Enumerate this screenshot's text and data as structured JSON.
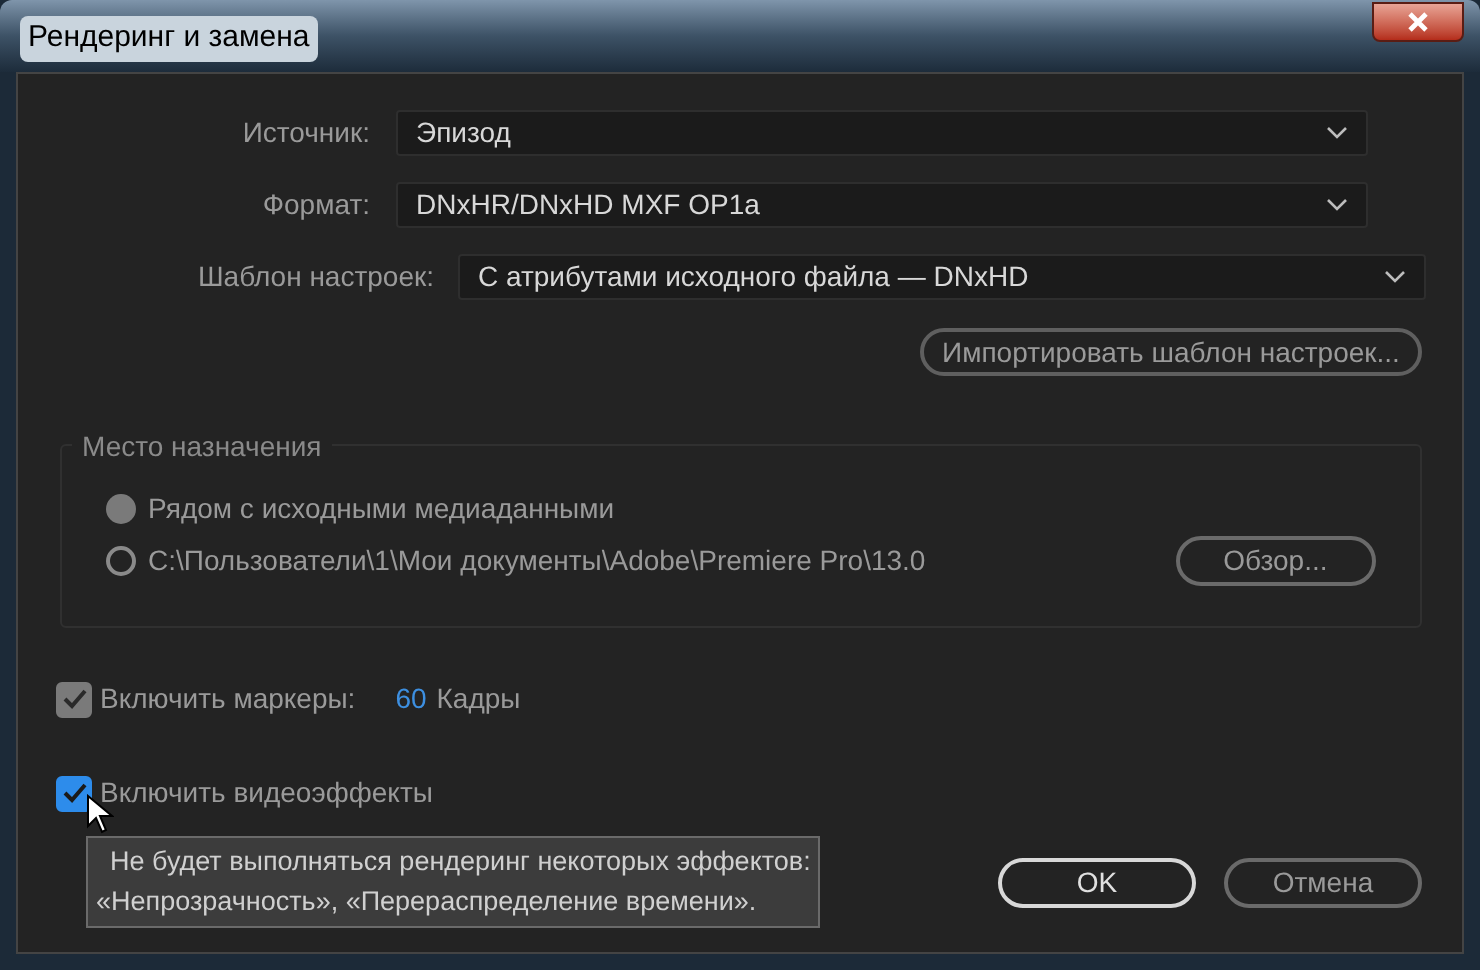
{
  "window": {
    "title": "Рендеринг и замена"
  },
  "source": {
    "label": "Источник:",
    "value": "Эпизод"
  },
  "format": {
    "label": "Формат:",
    "value": "DNxHR/DNxHD MXF OP1a"
  },
  "preset": {
    "label": "Шаблон настроек:",
    "value": "С атрибутами исходного файла — DNxHD"
  },
  "import_button": "Импортировать шаблон настроек...",
  "destination": {
    "title": "Место назначения",
    "options": [
      {
        "label": "Рядом с исходными медиаданными",
        "selected": true
      },
      {
        "label": "C:\\Пользователи\\1\\Мои документы\\Adobe\\Premiere Pro\\13.0",
        "selected": false
      }
    ],
    "browse_button": "Обзор..."
  },
  "markers": {
    "label": "Включить маркеры:",
    "checked": true,
    "disabled": true,
    "value": "60",
    "unit": "Кадры"
  },
  "effects": {
    "label": "Включить видеоэффекты",
    "checked": true,
    "disabled": false
  },
  "tooltip": {
    "lines": [
      "Не будет выполняться рендеринг некоторых эффектов:",
      "«Непрозрачность», «Перераспределение времени»."
    ]
  },
  "buttons": [
    {
      "label": "OK",
      "default": true
    },
    {
      "label": "Отмена",
      "default": false
    }
  ]
}
